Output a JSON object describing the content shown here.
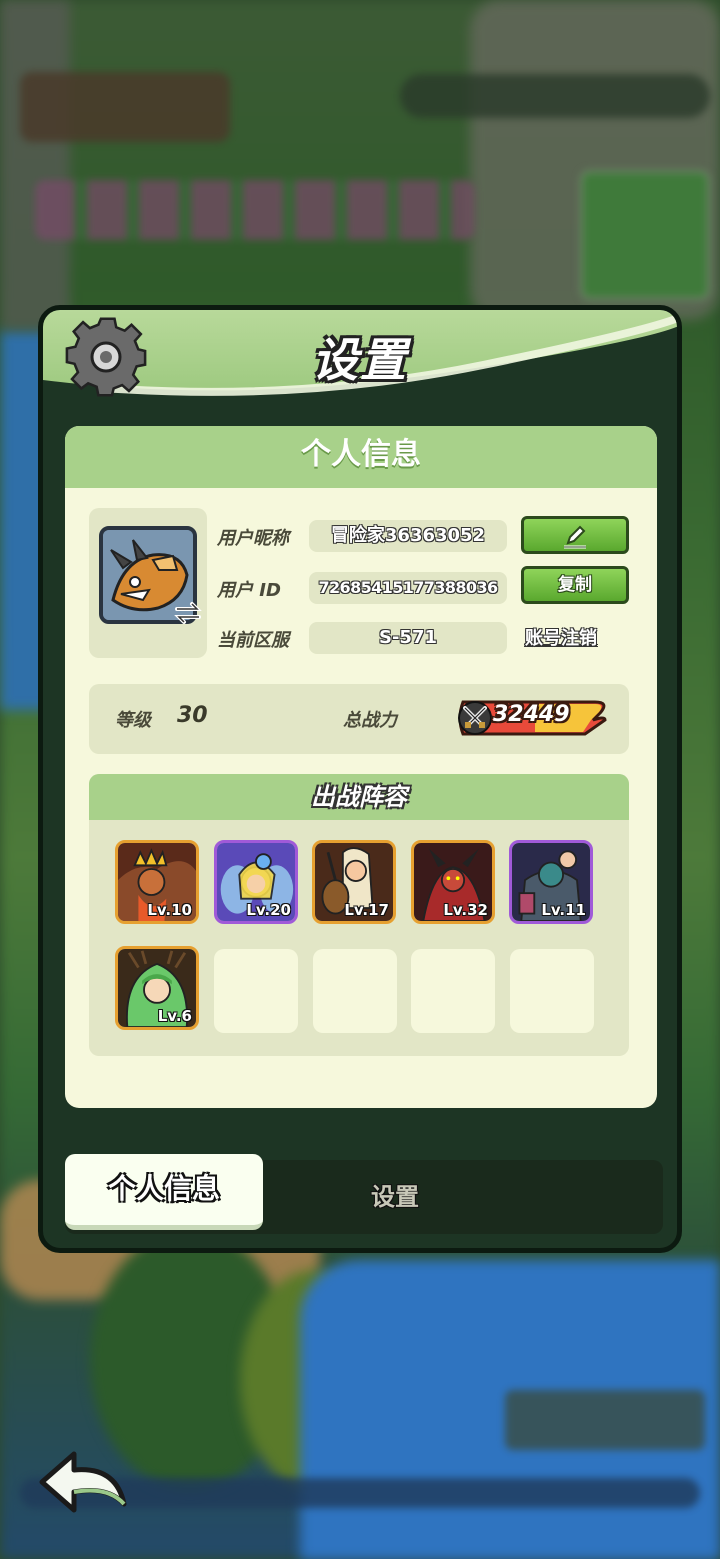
{
  "dialog": {
    "title": "设置",
    "panel_title": "个人信息"
  },
  "profile": {
    "nickname_label": "用户昵称",
    "nickname": "冒险家36363052",
    "id_label": "用户 ID",
    "user_id": "726854151773880​36",
    "server_label": "当前区服",
    "server": "S-571",
    "copy_button": "复制",
    "delete_account_link": "账号注销",
    "edit_icon": "pencil-icon",
    "swap_icon": "swap-arrows-icon"
  },
  "stats": {
    "level_label": "等级",
    "level": "30",
    "power_label": "总战力",
    "power": "32449",
    "power_icon": "crossed-swords-icon"
  },
  "lineup": {
    "title": "出战阵容",
    "heroes": [
      {
        "level": "Lv.10",
        "rarity": "legendary"
      },
      {
        "level": "Lv.20",
        "rarity": "epic"
      },
      {
        "level": "Lv.17",
        "rarity": "legendary"
      },
      {
        "level": "Lv.32",
        "rarity": "legendary"
      },
      {
        "level": "Lv.11",
        "rarity": "epic"
      },
      {
        "level": "Lv.6",
        "rarity": "legendary"
      }
    ],
    "empty_slots": 4
  },
  "tabs": {
    "active": "个人信息",
    "inactive": "设置"
  },
  "colors": {
    "header_green": "#a8d18a",
    "button_green": "#5aa82e",
    "panel_cream": "#f6f8dc",
    "legendary_frame": "#e6a030",
    "epic_frame": "#a05ad8",
    "power_badge": "#e84a3a"
  }
}
